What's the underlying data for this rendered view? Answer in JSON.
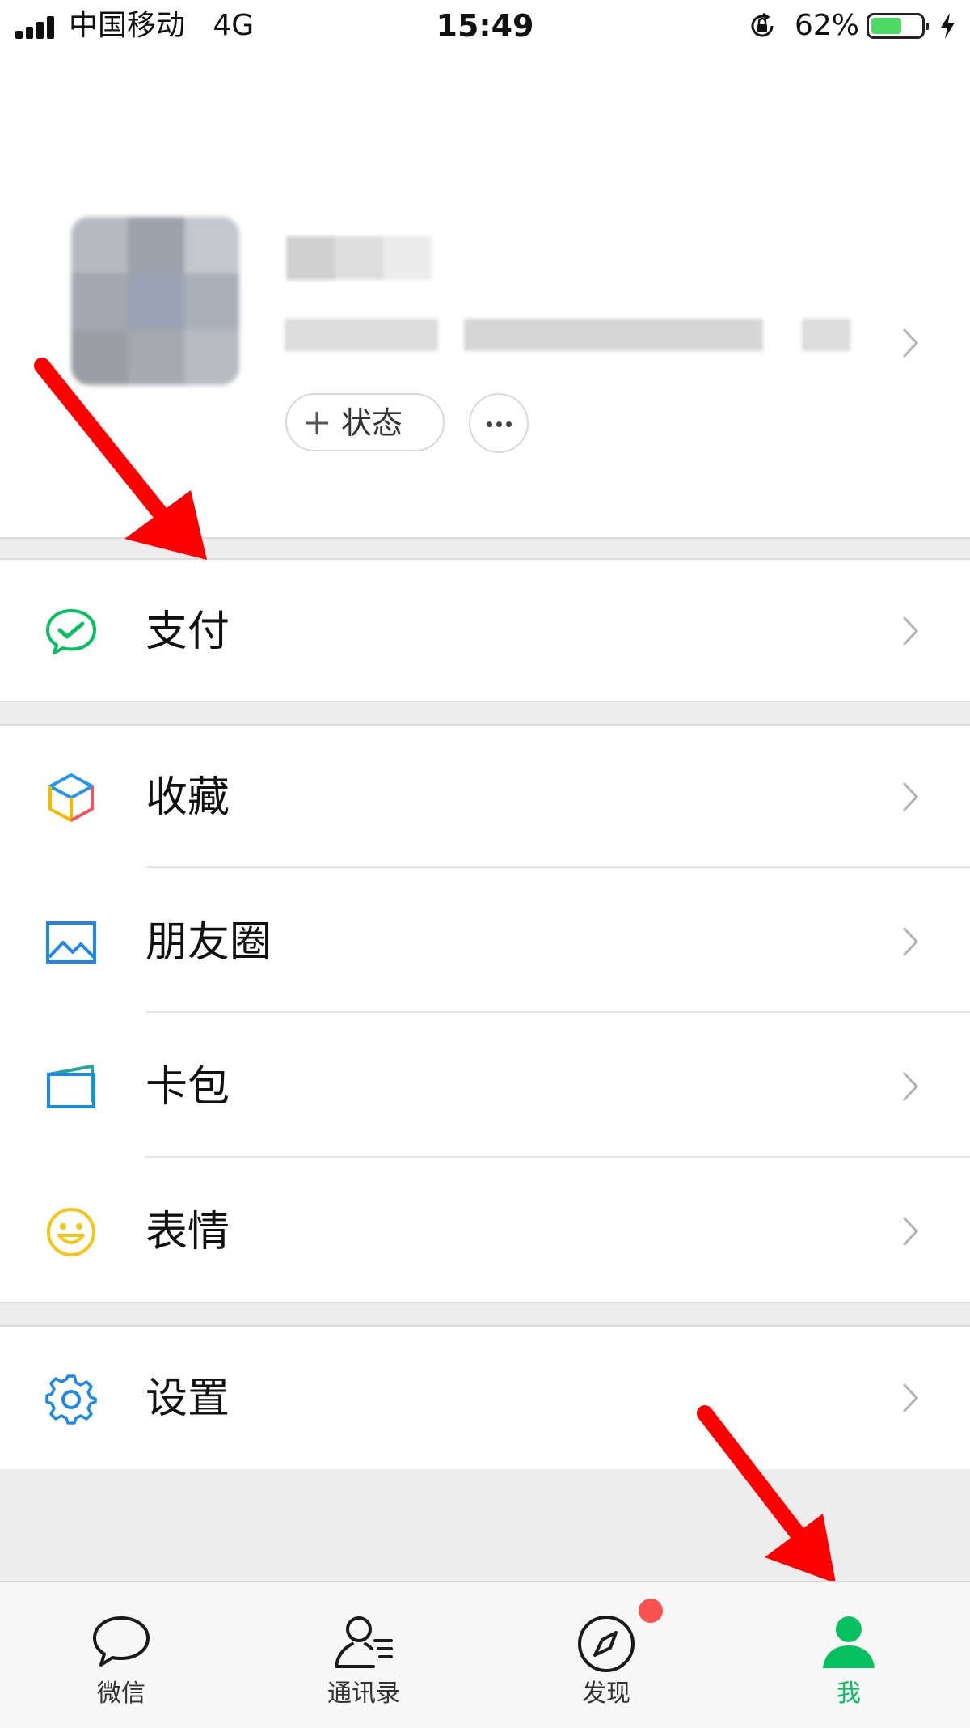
{
  "status_bar": {
    "carrier": "中国移动",
    "network": "4G",
    "time": "15:49",
    "battery_percent": "62%",
    "battery_level": 0.62,
    "battery_color": "#4cd964",
    "icons": [
      "signal-icon",
      "orientation-lock-icon",
      "battery-icon",
      "charging-bolt-icon"
    ]
  },
  "profile": {
    "nickname": "",
    "wechat_id": "",
    "status_button_label": "状态",
    "status_button_icon": "plus-icon",
    "more_button_icon": "more-dots-icon"
  },
  "menu": {
    "pay": {
      "label": "支付",
      "icon": "wechat-pay-icon",
      "color": "#07c160"
    },
    "favorites": {
      "label": "收藏",
      "icon": "favorites-cube-icon"
    },
    "moments": {
      "label": "朋友圈",
      "icon": "moments-photo-icon",
      "color": "#1e88e5"
    },
    "card_wallet": {
      "label": "卡包",
      "icon": "card-wallet-icon",
      "color": "#1e88e5"
    },
    "stickers": {
      "label": "表情",
      "icon": "smiley-icon",
      "color": "#f5c518"
    },
    "settings": {
      "label": "设置",
      "icon": "gear-icon",
      "color": "#1e88e5"
    }
  },
  "tab_bar": {
    "tabs": [
      {
        "label": "微信",
        "icon": "chat-bubble-icon",
        "active": false
      },
      {
        "label": "通讯录",
        "icon": "contacts-icon",
        "active": false
      },
      {
        "label": "发现",
        "icon": "compass-icon",
        "active": false,
        "badge": true
      },
      {
        "label": "我",
        "icon": "person-icon",
        "active": true
      }
    ],
    "active_color": "#07c160",
    "badge_color": "#fa5151"
  },
  "annotations": {
    "arrow_color": "#ff0000"
  }
}
